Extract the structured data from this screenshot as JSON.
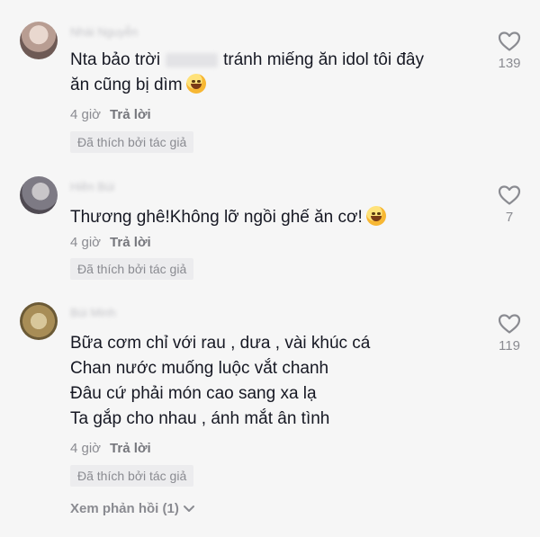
{
  "comments": [
    {
      "username": "Nhài Nguyễn",
      "lines": [
        "Nta bảo trời",
        "tránh miếng ăn idol tôi đây",
        "ăn cũng bị dìm"
      ],
      "time": "4 giờ",
      "reply": "Trả lời",
      "badge": "Đã thích bởi tác giả",
      "likes": "139",
      "emoji": "face-with-tears-of-joy"
    },
    {
      "username": "Hiền Bùi",
      "lines": [
        "Thương ghê!Không lỡ ngồi ghế ăn cơ!"
      ],
      "time": "4 giờ",
      "reply": "Trả lời",
      "badge": "Đã thích bởi tác giả",
      "likes": "7",
      "emoji": "grinning-face"
    },
    {
      "username": "Bùi Minh",
      "lines": [
        "Bữa cơm chỉ với rau , dưa , vài khúc cá",
        "Chan nước muống luộc vắt chanh",
        "Đâu cứ phải món cao sang xa lạ",
        "Ta gắp cho nhau , ánh mắt ân tình"
      ],
      "time": "4 giờ",
      "reply": "Trả lời",
      "badge": "Đã thích bởi tác giả",
      "likes": "119"
    }
  ],
  "view_replies": "Xem phản hồi (1)",
  "icons": {
    "like": "heart-outline-icon",
    "expand": "chevron-down-icon"
  }
}
